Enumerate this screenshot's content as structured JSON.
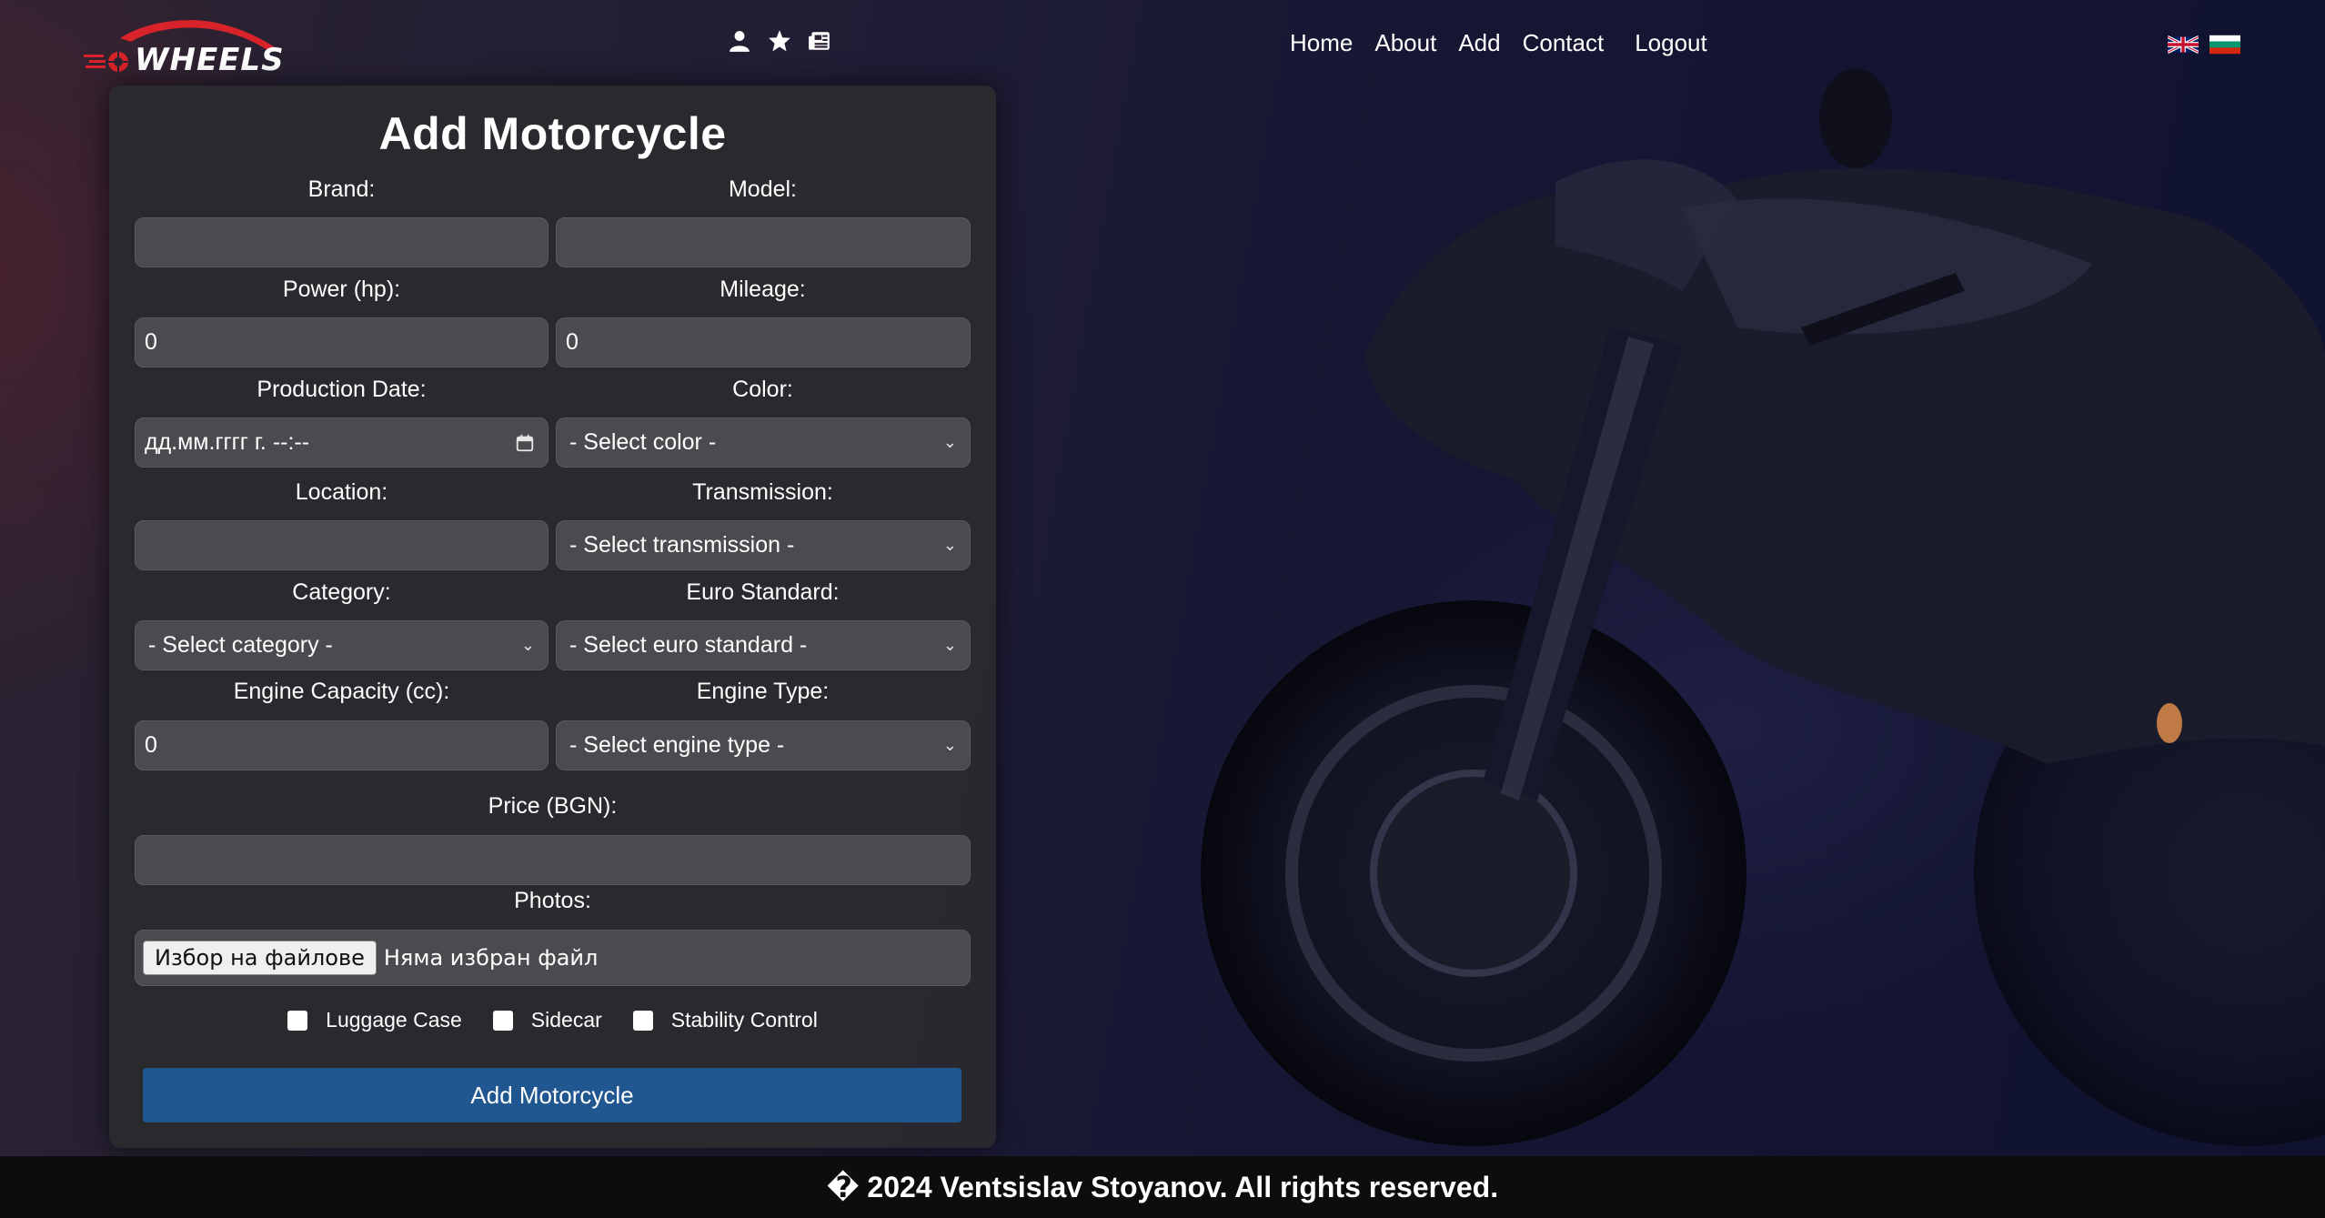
{
  "header": {
    "brand": "WHEELS",
    "icons": [
      "user-icon",
      "star-icon",
      "newspaper-icon"
    ],
    "nav": [
      "Home",
      "About",
      "Add",
      "Contact",
      "Logout"
    ],
    "languages": [
      "en-flag",
      "bg-flag"
    ]
  },
  "form": {
    "title": "Add Motorcycle",
    "brand_label": "Brand:",
    "model_label": "Model:",
    "power_label": "Power (hp):",
    "power_value": "0",
    "mileage_label": "Mileage:",
    "mileage_value": "0",
    "production_date_label": "Production Date:",
    "production_date_placeholder": "дд.мм.гггг г. --:--",
    "color_label": "Color:",
    "color_selected": "- Select color -",
    "location_label": "Location:",
    "transmission_label": "Transmission:",
    "transmission_selected": "- Select transmission -",
    "category_label": "Category:",
    "category_selected": "- Select category -",
    "euro_label": "Euro Standard:",
    "euro_selected": "- Select euro standard -",
    "engine_capacity_label": "Engine Capacity (cc):",
    "engine_capacity_value": "0",
    "engine_type_label": "Engine Type:",
    "engine_type_selected": "- Select engine type -",
    "price_label": "Price (BGN):",
    "photos_label": "Photos:",
    "file_button": "Избор на файлове",
    "file_status": "Няма избран файл",
    "checkboxes": [
      "Luggage Case",
      "Sidecar",
      "Stability Control"
    ],
    "submit_label": "Add Motorcycle"
  },
  "footer": {
    "text": "� 2024 Ventsislav Stoyanov. All rights reserved."
  },
  "colors": {
    "card": "#2a2a2e",
    "input": "#4b4b4f",
    "submit": "#215790",
    "logo_red": "#d8232a"
  }
}
